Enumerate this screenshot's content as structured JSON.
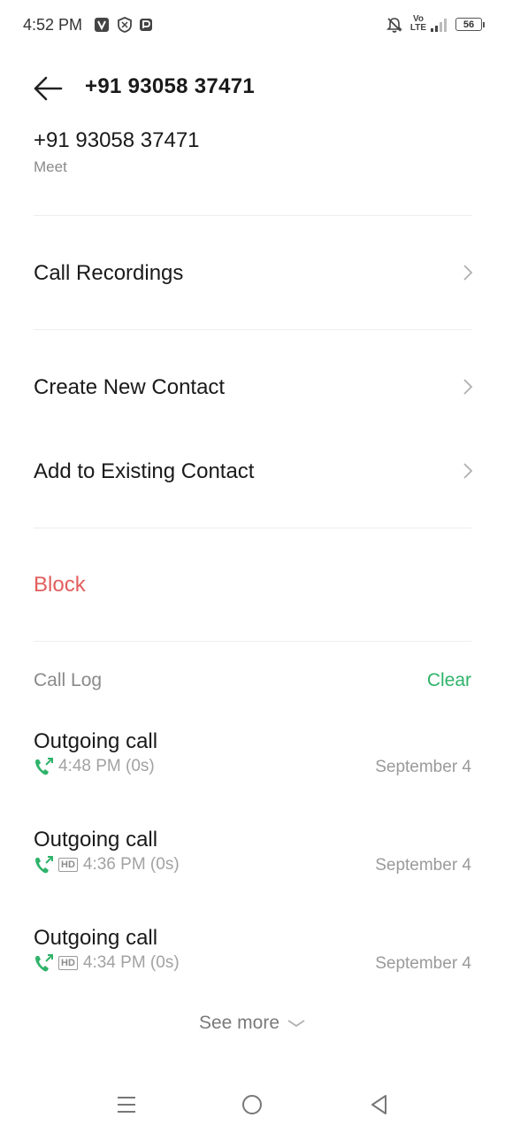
{
  "status_bar": {
    "time": "4:52 PM",
    "network_label_top": "Vo",
    "network_label_bottom": "LTE",
    "battery": "56"
  },
  "header": {
    "title": "+91 93058 37471"
  },
  "contact": {
    "number": "+91 93058 37471",
    "location": "Meet"
  },
  "menu": {
    "call_recordings": "Call Recordings",
    "create_new_contact": "Create New Contact",
    "add_to_existing_contact": "Add to Existing Contact",
    "block": "Block"
  },
  "call_log": {
    "title": "Call Log",
    "clear_label": "Clear",
    "hd_badge": "HD",
    "entries": [
      {
        "type": "Outgoing call",
        "time": "4:48 PM (0s)",
        "date": "September 4",
        "hd": false
      },
      {
        "type": "Outgoing call",
        "time": "4:36 PM (0s)",
        "date": "September 4",
        "hd": true
      },
      {
        "type": "Outgoing call",
        "time": "4:34 PM (0s)",
        "date": "September 4",
        "hd": true
      }
    ],
    "see_more": "See more"
  },
  "colors": {
    "accent_green": "#2fb36a",
    "block_red": "#e35d5d",
    "secondary_text": "#8a8a8a"
  },
  "icons": {
    "back": "back-arrow-icon",
    "chevron": "chevron-right-icon",
    "outgoing": "outgoing-call-icon",
    "nav_menu": "menu-icon",
    "nav_home": "home-icon",
    "nav_back": "back-triangle-icon"
  }
}
